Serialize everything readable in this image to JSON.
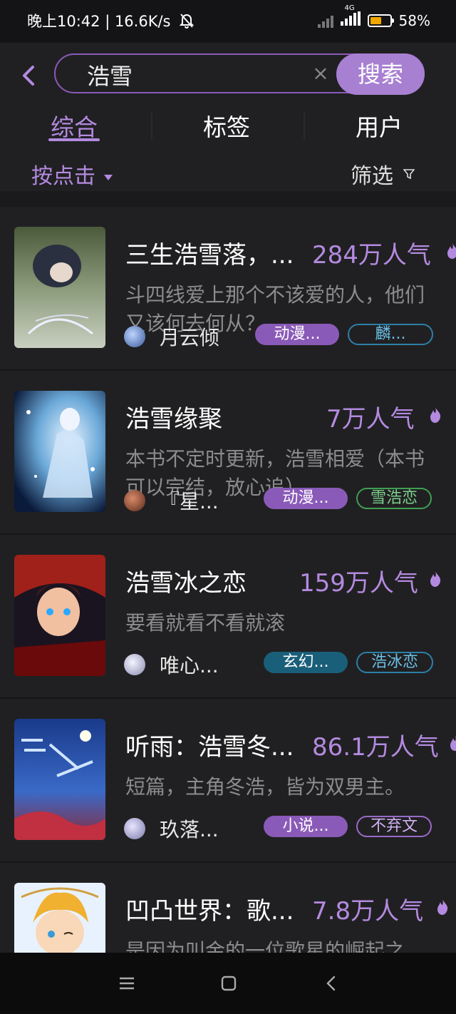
{
  "status": {
    "time_speed": "晚上10:42 | 16.6K/s",
    "network": "4G",
    "battery_percent": "58%",
    "battery_level": 0.58
  },
  "search": {
    "query": "浩雪",
    "button_label": "搜索"
  },
  "tabs": [
    {
      "label": "综合",
      "active": true
    },
    {
      "label": "标签",
      "active": false
    },
    {
      "label": "用户",
      "active": false
    }
  ],
  "sort": {
    "label": "按点击"
  },
  "filter": {
    "label": "筛选"
  },
  "results": [
    {
      "title": "三生浩雪落，...",
      "popularity": "284万人气",
      "description": "斗四线爱上那个不该爱的人，他们又该何去何从？",
      "author": "月云倾",
      "tags": [
        "动漫...",
        "麟..."
      ]
    },
    {
      "title": "浩雪缘聚",
      "popularity": "7万人气",
      "description": "本书不定时更新，浩雪相爱（本书可以完结，放心追）",
      "author": "『星...",
      "tags": [
        "动漫...",
        "雪浩恋"
      ]
    },
    {
      "title": "浩雪冰之恋",
      "popularity": "159万人气",
      "description": "要看就看不看就滚",
      "author": "唯心...",
      "tags": [
        "玄幻...",
        "浩冰恋"
      ]
    },
    {
      "title": "听雨：浩雪冬...",
      "popularity": "86.1万人气",
      "description": "短篇，主角冬浩，皆为双男主。",
      "author": "玖落...",
      "tags": [
        "小说...",
        "不弃文"
      ]
    },
    {
      "title": "凹凸世界：歌...",
      "popularity": "7.8万人气",
      "description": "是因为叫金的一位歌星的崛起之",
      "author": "",
      "tags": []
    }
  ],
  "colors": {
    "accent": "#b48ae0",
    "background": "#202022",
    "search_button": "#a880d2"
  }
}
